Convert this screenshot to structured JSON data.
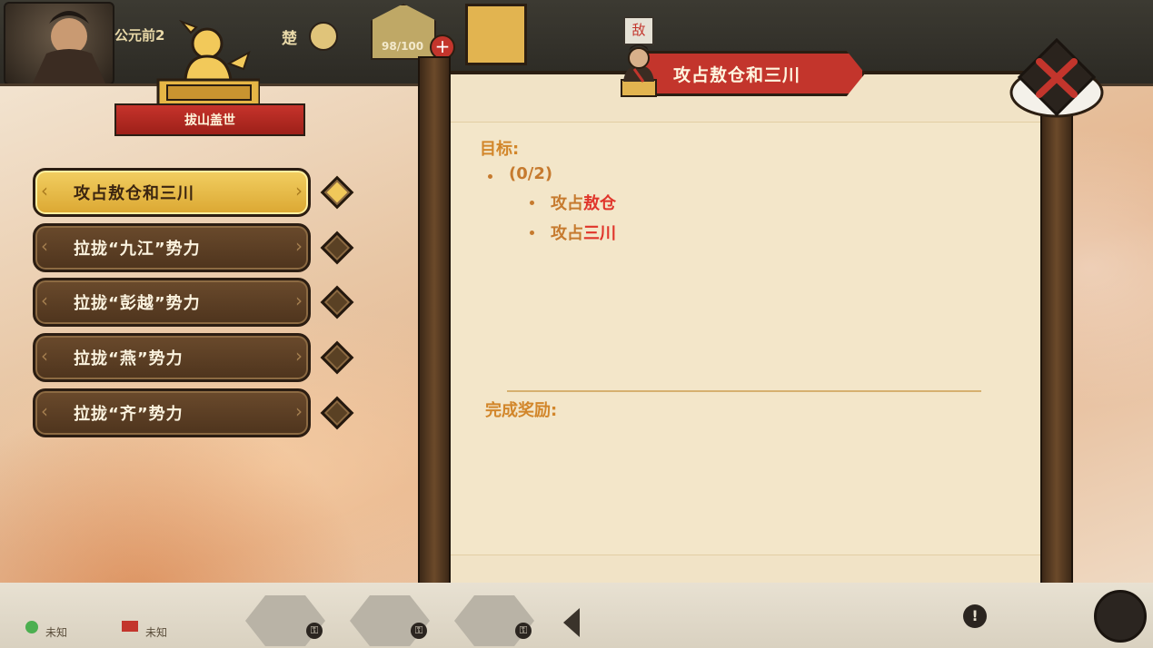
{
  "top_hud": {
    "era_prefix": "公元前2",
    "faction": "楚",
    "counter": "98/100"
  },
  "emblem": {
    "banner_text": "拔山盖世"
  },
  "quests": [
    {
      "label": "攻占敖仓和三川",
      "selected": true
    },
    {
      "label": "拉拢“九江”势力",
      "selected": false
    },
    {
      "label": "拉拢“彭越”势力",
      "selected": false
    },
    {
      "label": "拉拢“燕”势力",
      "selected": false
    },
    {
      "label": "拉拢“齐”势力",
      "selected": false
    }
  ],
  "detail": {
    "title": "攻占敖仓和三川",
    "objective_heading": "目标:",
    "progress": "(0/2)",
    "objectives": [
      {
        "verb": "攻占",
        "target": "敖仓"
      },
      {
        "verb": "攻占",
        "target": "三川"
      }
    ],
    "reward_heading": "完成奖励:"
  },
  "bottom": {
    "unknown_a": "未知",
    "unknown_b": "未知"
  },
  "colors": {
    "ribbon_red": "#c3352c",
    "selected_gold": "#f2cf62",
    "objective_orange": "#c67a2e",
    "objective_highlight": "#e0342a"
  }
}
